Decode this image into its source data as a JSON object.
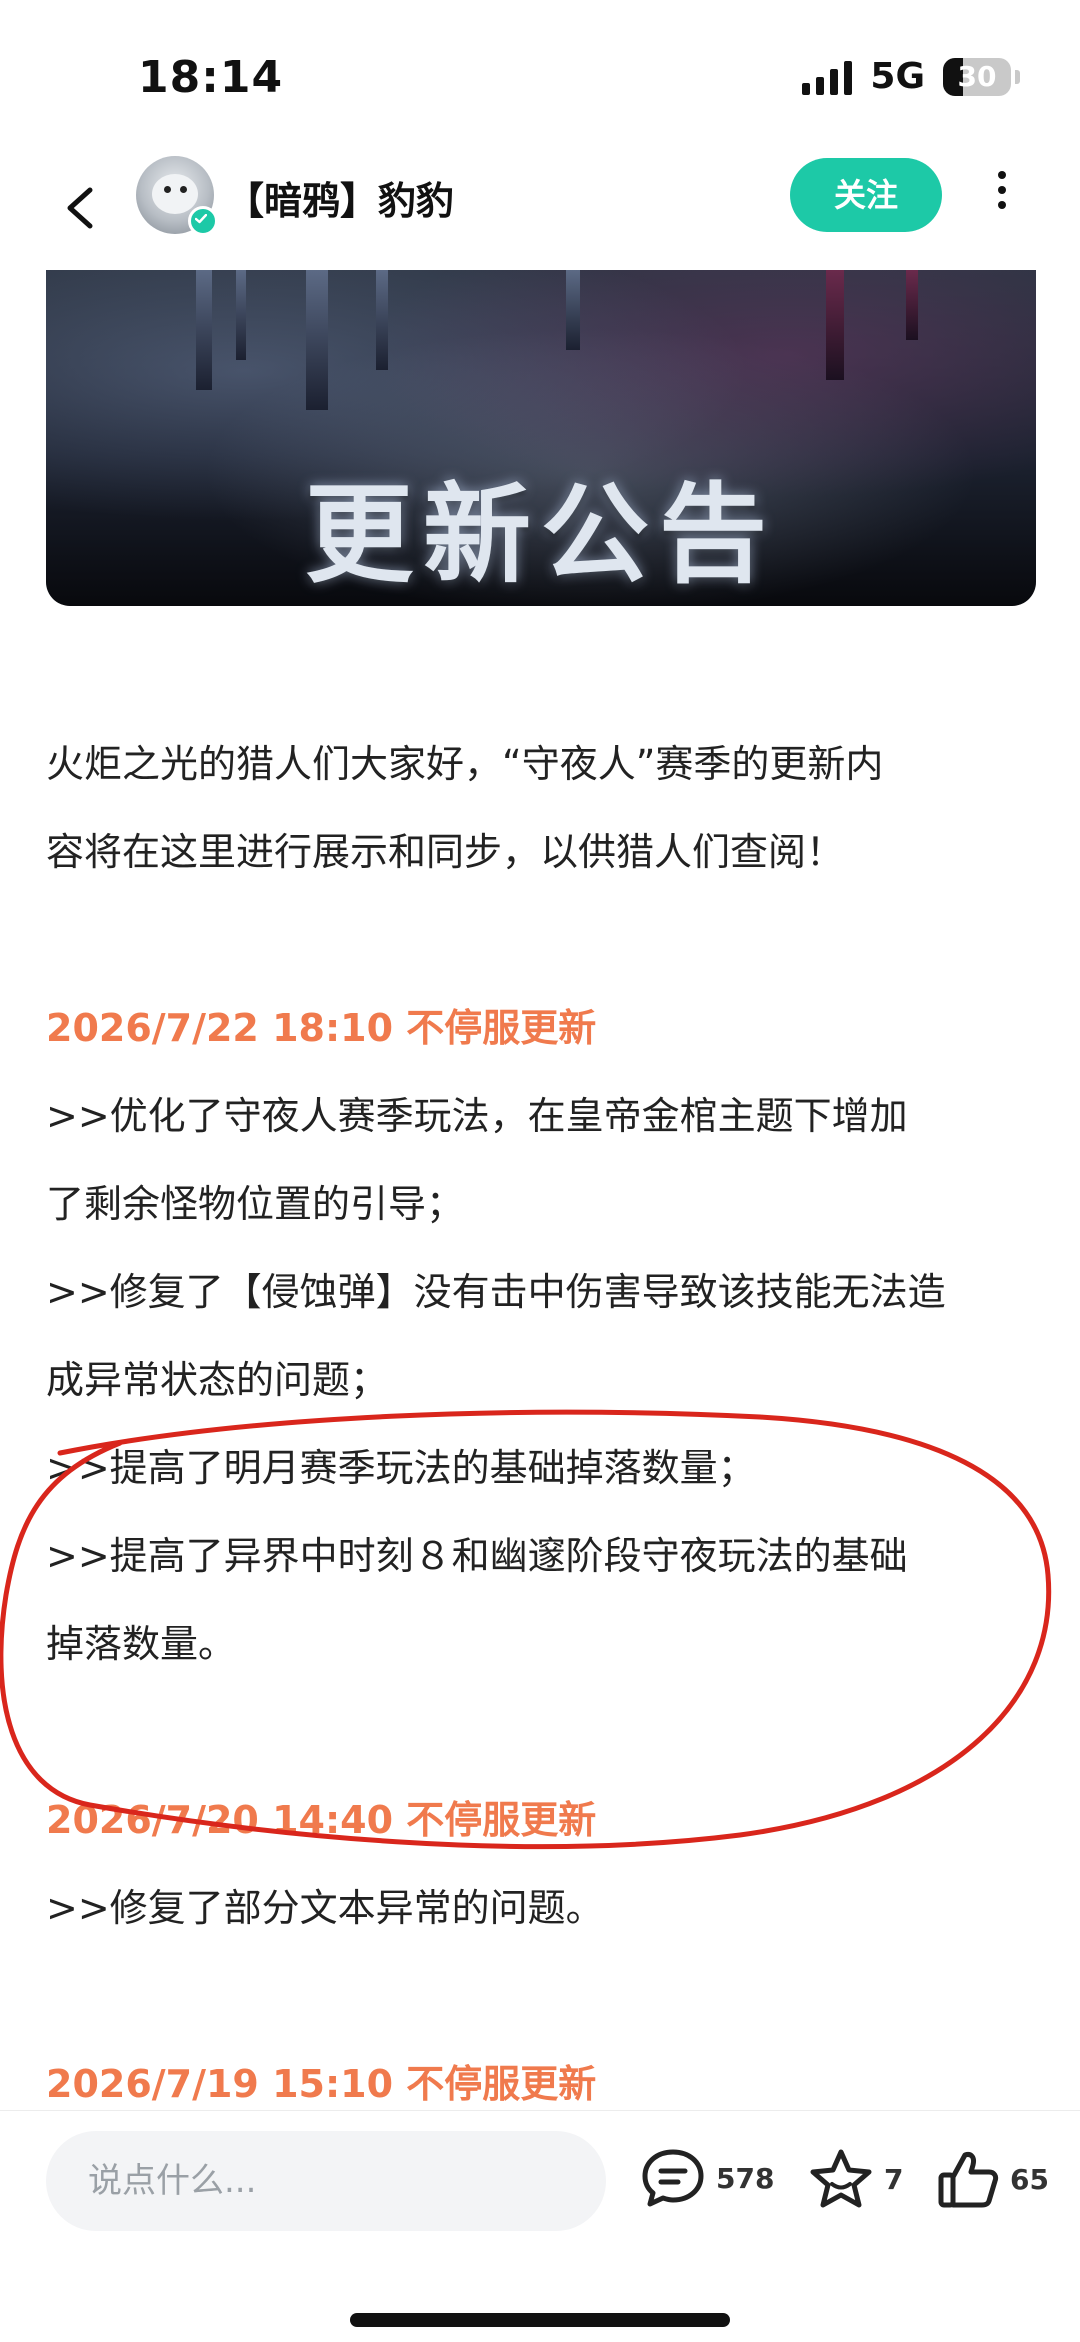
{
  "status_bar": {
    "time": "18:14",
    "network": "5G",
    "battery_level": "30",
    "battery_fraction": 0.3
  },
  "nav": {
    "back_icon": "chevron-left-icon",
    "author_name": "【暗鸦】豹豹",
    "follow_label": "关注",
    "more_icon": "more-vertical-icon",
    "verified_color": "#1dc9a7"
  },
  "banner": {
    "title": "更新公告"
  },
  "article": {
    "intro_line1": "火炬之光的猎人们大家好，“守夜人”赛季的更新内",
    "intro_line2": "容将在这里进行展示和同步，以供猎人们查阅！",
    "updates": [
      {
        "date": "2026/7/22 18:10 不停服更新",
        "lines": [
          ">>优化了守夜人赛季玩法，在皇帝金棺主题下增加",
          "了剩余怪物位置的引导；",
          ">>修复了【侵蚀弹】没有击中伤害导致该技能无法造",
          "成异常状态的问题；",
          ">>提高了明月赛季玩法的基础掉落数量；",
          ">>提高了异界中时刻８和幽邃阶段守夜玩法的基础",
          "掉落数量。"
        ]
      },
      {
        "date": "2026/7/20 14:40 不停服更新",
        "lines": [
          ">>修复了部分文本异常的问题。"
        ]
      },
      {
        "date": "2026/7/19 15:10 不停服更新",
        "lines": []
      }
    ],
    "accent_color": "#f07a4d",
    "annotation_color": "#d9261c"
  },
  "bottom_bar": {
    "comment_placeholder": "说点什么...",
    "comment_count": "578",
    "favorite_count": "7",
    "like_count": "65",
    "comment_icon": "comment-bubble-icon",
    "favorite_icon": "star-icon",
    "like_icon": "thumbs-up-icon"
  }
}
